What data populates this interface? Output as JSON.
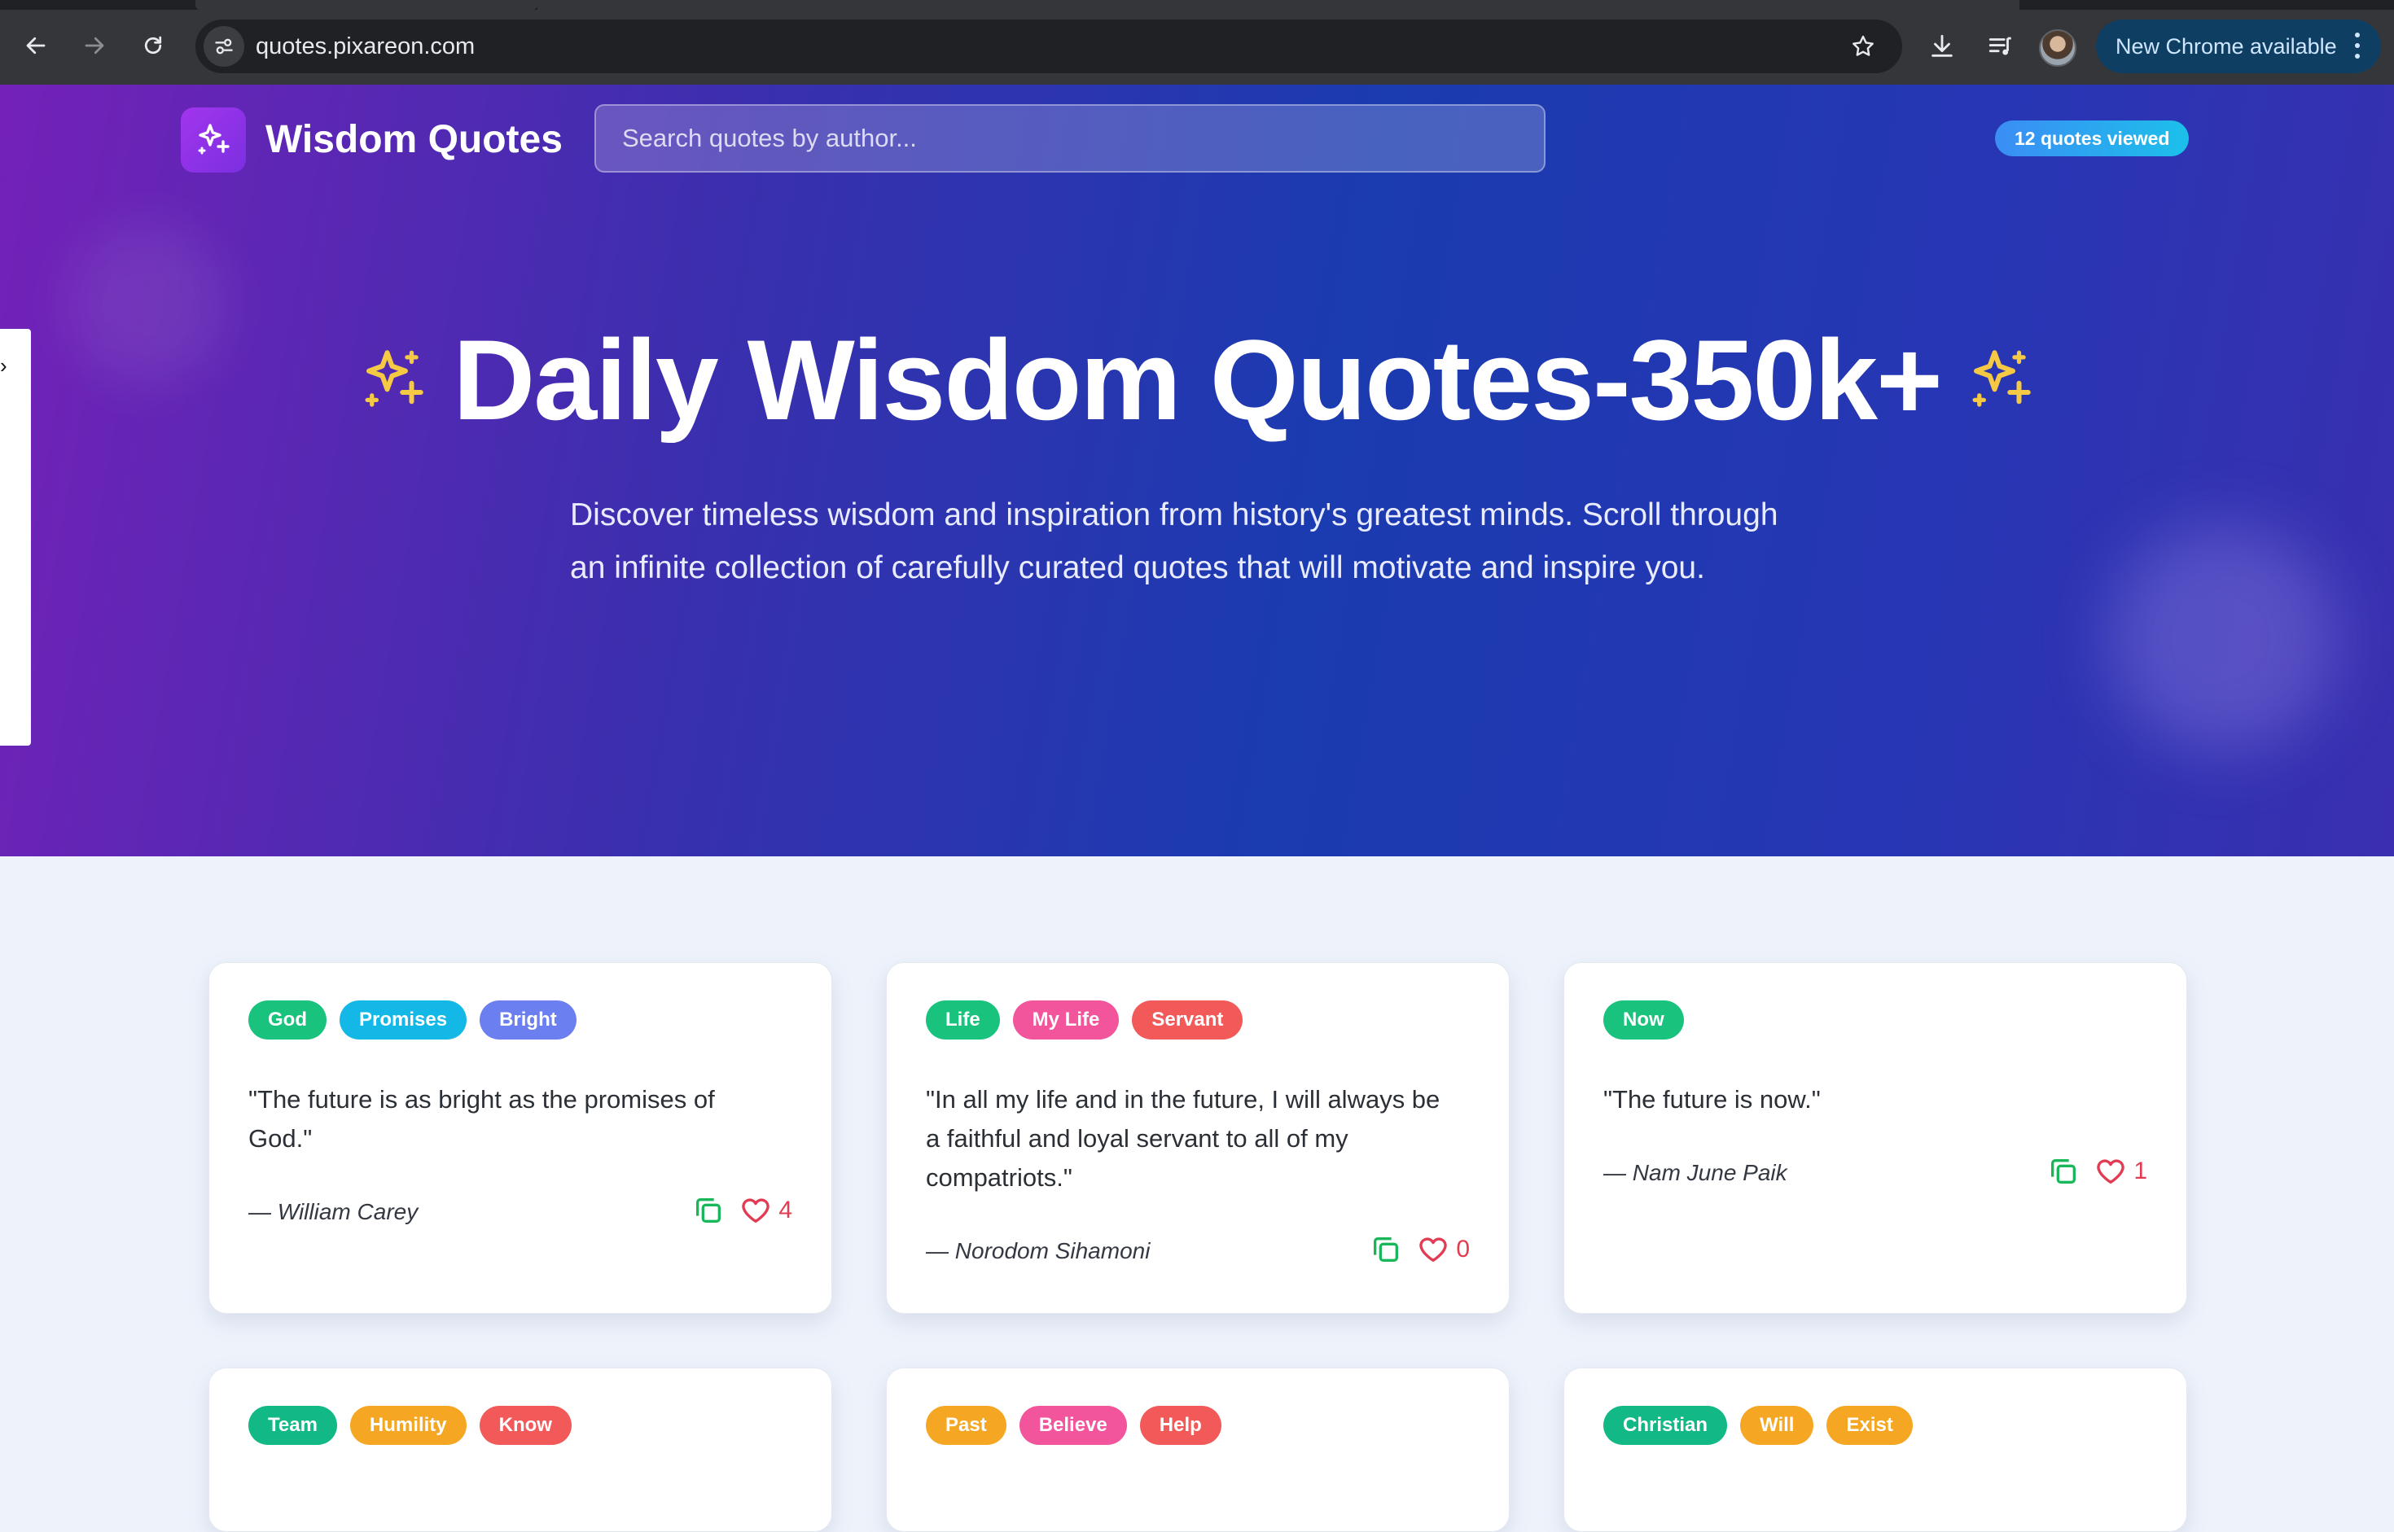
{
  "browser": {
    "url": "quotes.pixareon.com",
    "update_label": "New Chrome available"
  },
  "header": {
    "brand": "Wisdom Quotes",
    "search_placeholder": "Search quotes by author...",
    "viewed_badge": "12 quotes viewed"
  },
  "hero": {
    "title": "Daily Wisdom Quotes-350k+",
    "description_line1": "Discover timeless wisdom and inspiration from history's greatest minds. Scroll through",
    "description_line2": "an infinite collection of carefully curated quotes that will motivate and inspire you."
  },
  "quotes": [
    {
      "tags": [
        {
          "label": "God",
          "color": "#19c37d"
        },
        {
          "label": "Promises",
          "color": "#14b8e6"
        },
        {
          "label": "Bright",
          "color": "#6b7ff0"
        }
      ],
      "text_line1": "\"The future is as bright as the promises of",
      "text_line2": "God.\"",
      "text_line3": "",
      "author": "— William Carey",
      "likes": "4"
    },
    {
      "tags": [
        {
          "label": "Life",
          "color": "#19c37d"
        },
        {
          "label": "My Life",
          "color": "#f2559b"
        },
        {
          "label": "Servant",
          "color": "#f25a5a"
        }
      ],
      "text_line1": "\"In all my life and in the future, I will always be",
      "text_line2": "a faithful and loyal servant to all of my",
      "text_line3": "compatriots.\"",
      "author": "— Norodom Sihamoni",
      "likes": "0"
    },
    {
      "tags": [
        {
          "label": "Now",
          "color": "#19c37d"
        }
      ],
      "text_line1": "\"The future is now.\"",
      "text_line2": "",
      "text_line3": "",
      "author": "— Nam June Paik",
      "likes": "1"
    },
    {
      "tags": [
        {
          "label": "Team",
          "color": "#12b886"
        },
        {
          "label": "Humility",
          "color": "#f5a623"
        },
        {
          "label": "Know",
          "color": "#f25a5a"
        }
      ]
    },
    {
      "tags": [
        {
          "label": "Past",
          "color": "#f5a623"
        },
        {
          "label": "Believe",
          "color": "#f2559b"
        },
        {
          "label": "Help",
          "color": "#f25a5a"
        }
      ]
    },
    {
      "tags": [
        {
          "label": "Christian",
          "color": "#12b886"
        },
        {
          "label": "Will",
          "color": "#f5a623"
        },
        {
          "label": "Exist",
          "color": "#f5a623"
        }
      ]
    }
  ],
  "colors": {
    "copy_icon": "#19b65a",
    "heart_icon": "#e23b52",
    "sparkle": "#f6c944"
  }
}
